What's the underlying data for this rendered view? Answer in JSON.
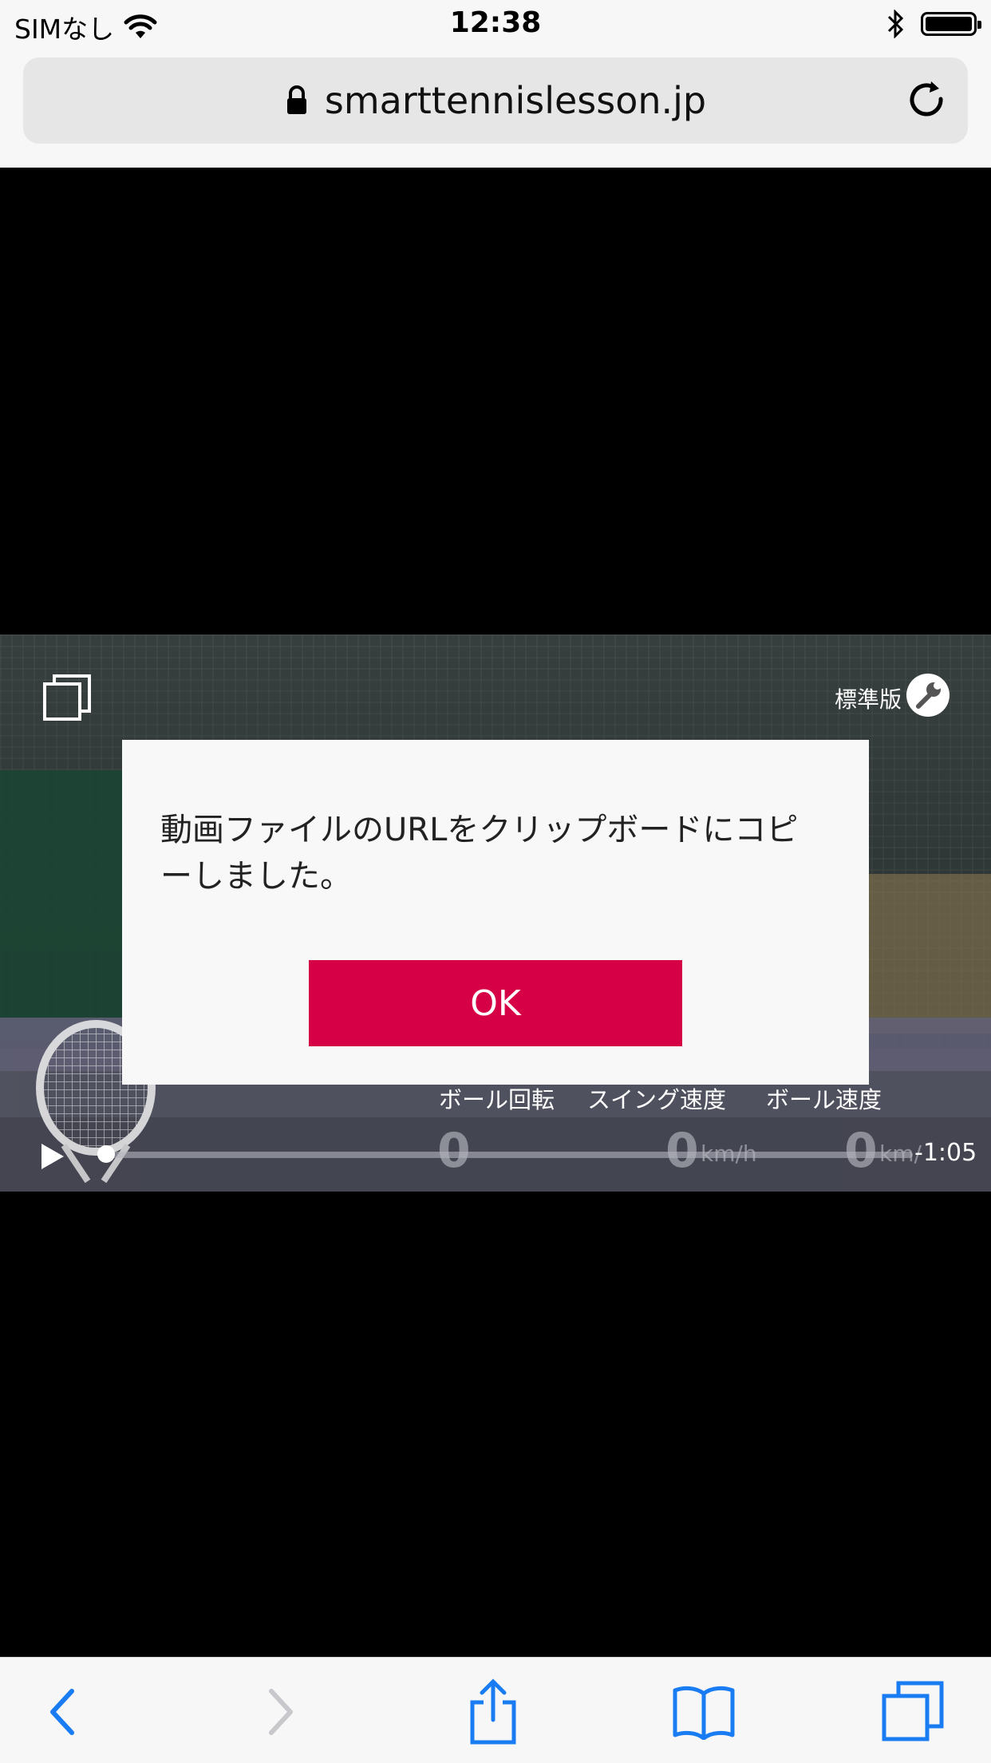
{
  "status_bar": {
    "carrier": "SIMなし",
    "time": "12:38",
    "icons": [
      "wifi-icon",
      "bluetooth-icon",
      "battery-icon"
    ]
  },
  "browser": {
    "url": "smarttennislesson.jp",
    "secure": true,
    "icons": [
      "lock-icon",
      "reload-icon"
    ]
  },
  "video": {
    "edition_label": "標準版",
    "stats": [
      {
        "label": "ボール回転",
        "value": "0",
        "unit": ""
      },
      {
        "label": "スイング速度",
        "value": "0",
        "unit": "km/h"
      },
      {
        "label": "ボール速度",
        "value": "0",
        "unit": "km/"
      }
    ],
    "time_remaining": "-1:05",
    "progress": 0
  },
  "dialog": {
    "message": "動画ファイルのURLをクリップボードにコピーしました。",
    "ok_label": "OK",
    "accent_color": "#d60046"
  },
  "toolbar": {
    "items": [
      "back-icon",
      "forward-icon",
      "share-icon",
      "bookmarks-icon",
      "tabs-icon"
    ],
    "accent_color": "#1a7cf2"
  }
}
